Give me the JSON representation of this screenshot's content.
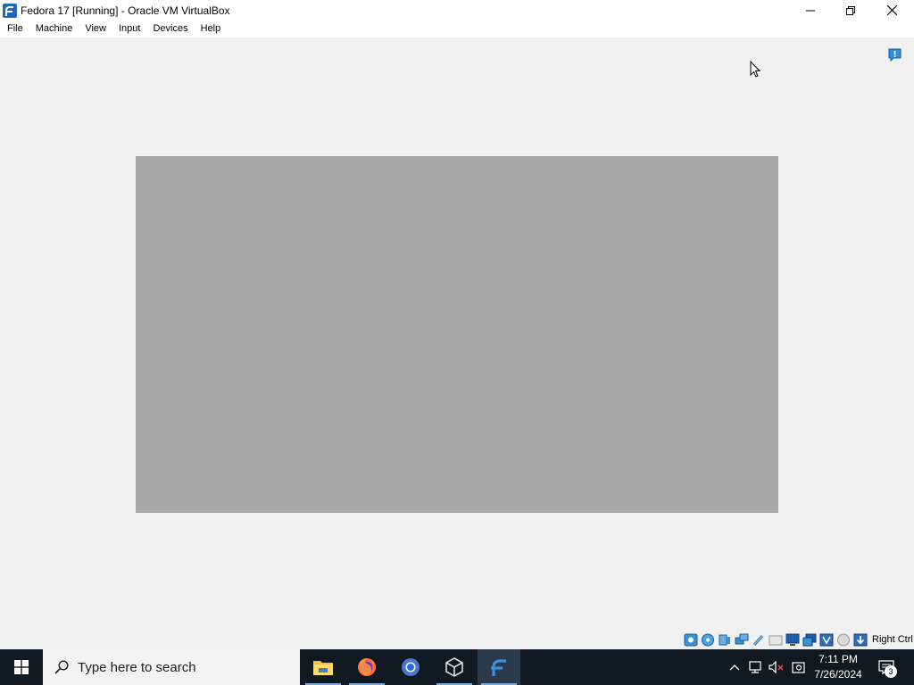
{
  "window": {
    "title": "Fedora 17 [Running] - Oracle VM VirtualBox",
    "app_icon": "fedora-logo-icon",
    "controls": [
      "minimize-icon",
      "restore-icon",
      "close-icon"
    ]
  },
  "menubar": {
    "items": [
      {
        "label": "File"
      },
      {
        "label": "Machine"
      },
      {
        "label": "View"
      },
      {
        "label": "Input"
      },
      {
        "label": "Devices"
      },
      {
        "label": "Help"
      }
    ]
  },
  "vm": {
    "screen_color": "#a8a8a8",
    "notification_icon": "info-balloon-icon"
  },
  "statusbar": {
    "icons": [
      "hard-disk-icon",
      "optical-drive-icon",
      "audio-icon",
      "network-icon",
      "usb-icon",
      "shared-folders-icon",
      "display-icon",
      "video-capture-icon",
      "virtualization-icon",
      "mouse-integration-icon",
      "host-key-arrow-icon"
    ],
    "host_key": "Right Ctrl"
  },
  "taskbar": {
    "search_placeholder": "Type here to search",
    "apps": [
      {
        "name": "file-explorer-icon"
      },
      {
        "name": "firefox-icon"
      },
      {
        "name": "chrome-icon"
      },
      {
        "name": "virtualbox-icon"
      },
      {
        "name": "fedora-vm-icon"
      }
    ],
    "tray_icons": [
      "chevron-up-icon",
      "network-icon",
      "speaker-muted-icon",
      "notification-center-icon"
    ],
    "time": "7:11 PM",
    "date": "7/26/2024",
    "notification_count": "3"
  }
}
